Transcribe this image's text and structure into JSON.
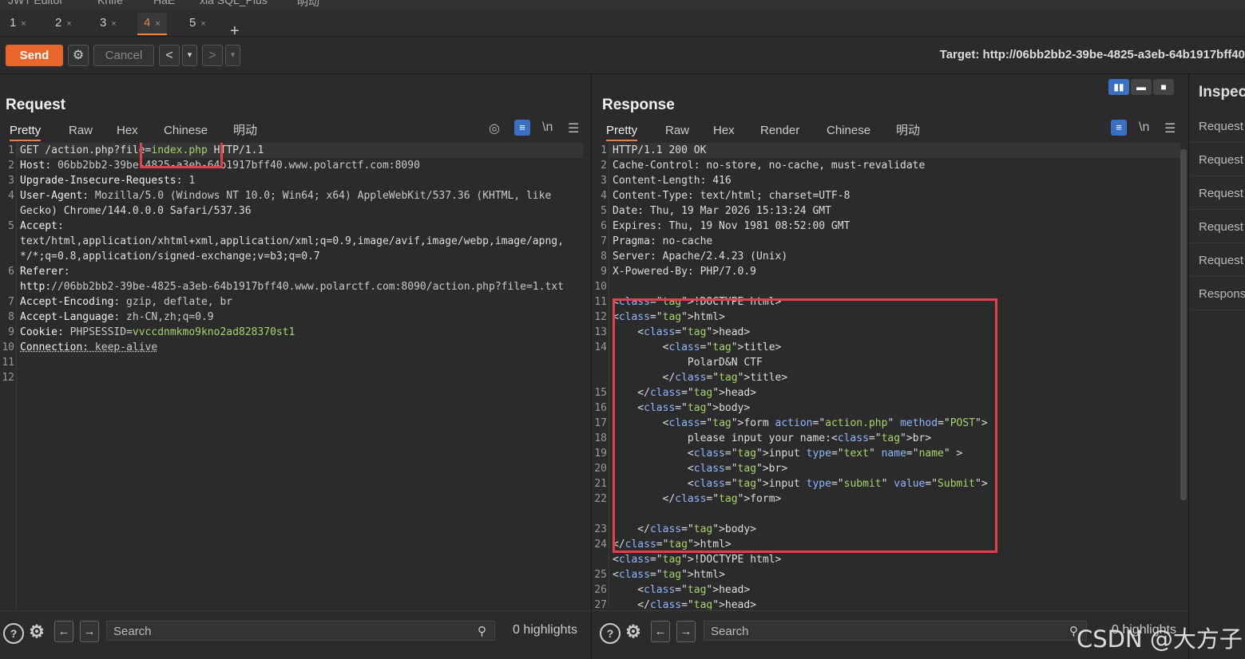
{
  "top_strip": [
    "JWT Editor",
    "Knife",
    "HaE",
    "xia SQL_Plus",
    "明动"
  ],
  "tabs": [
    {
      "label": "1",
      "active": false
    },
    {
      "label": "2",
      "active": false
    },
    {
      "label": "3",
      "active": false
    },
    {
      "label": "4",
      "active": true
    },
    {
      "label": "5",
      "active": false
    }
  ],
  "tab_close": "×",
  "toolbar": {
    "send_label": "Send",
    "cancel_label": "Cancel",
    "back_label": "<",
    "forward_label": ">",
    "dropdown": "▾",
    "target": "Target: http://06bb2bb2-39be-4825-a3eb-64b1917bff40"
  },
  "request": {
    "title": "Request",
    "tabs": [
      "Pretty",
      "Raw",
      "Hex",
      "Chinese",
      "明动"
    ],
    "active_tab": "Pretty",
    "newline_toggle": "\\n",
    "lines": [
      {
        "n": "1",
        "text": "GET /action.php?file=index.php HTTP/1.1"
      },
      {
        "n": "2",
        "text": "Host: 06bb2bb2-39be-4825-a3eb-64b1917bff40.www.polarctf.com:8090"
      },
      {
        "n": "3",
        "text": "Upgrade-Insecure-Requests: 1"
      },
      {
        "n": "4",
        "text": "User-Agent: Mozilla/5.0 (Windows NT 10.0; Win64; x64) AppleWebKit/537.36 (KHTML, like"
      },
      {
        "n": "",
        "text": "Gecko) Chrome/144.0.0.0 Safari/537.36"
      },
      {
        "n": "5",
        "text": "Accept:"
      },
      {
        "n": "",
        "text": "text/html,application/xhtml+xml,application/xml;q=0.9,image/avif,image/webp,image/apng,"
      },
      {
        "n": "",
        "text": "*/*;q=0.8,application/signed-exchange;v=b3;q=0.7"
      },
      {
        "n": "6",
        "text": "Referer:"
      },
      {
        "n": "",
        "text": "http://06bb2bb2-39be-4825-a3eb-64b1917bff40.www.polarctf.com:8090/action.php?file=1.txt"
      },
      {
        "n": "7",
        "text": "Accept-Encoding: gzip, deflate, br"
      },
      {
        "n": "8",
        "text": "Accept-Language: zh-CN,zh;q=0.9"
      },
      {
        "n": "9",
        "text": "Cookie: PHPSESSID=vvccdnmkmo9kno2ad828370st1"
      },
      {
        "n": "10",
        "text": "Connection: keep-alive"
      },
      {
        "n": "11",
        "text": ""
      },
      {
        "n": "12",
        "text": ""
      }
    ],
    "search_placeholder": "Search",
    "highlights": "0 highlights"
  },
  "response": {
    "title": "Response",
    "tabs": [
      "Pretty",
      "Raw",
      "Hex",
      "Render",
      "Chinese",
      "明动"
    ],
    "active_tab": "Pretty",
    "newline_toggle": "\\n",
    "lines": [
      {
        "n": "1",
        "text": "HTTP/1.1 200 OK"
      },
      {
        "n": "2",
        "text": "Cache-Control: no-store, no-cache, must-revalidate"
      },
      {
        "n": "3",
        "text": "Content-Length: 416"
      },
      {
        "n": "4",
        "text": "Content-Type: text/html; charset=UTF-8"
      },
      {
        "n": "5",
        "text": "Date: Thu, 19 Mar 2026 15:13:24 GMT"
      },
      {
        "n": "6",
        "text": "Expires: Thu, 19 Nov 1981 08:52:00 GMT"
      },
      {
        "n": "7",
        "text": "Pragma: no-cache"
      },
      {
        "n": "8",
        "text": "Server: Apache/2.4.23 (Unix)"
      },
      {
        "n": "9",
        "text": "X-Powered-By: PHP/7.0.9"
      },
      {
        "n": "10",
        "text": ""
      },
      {
        "n": "11",
        "text": "<!DOCTYPE html>"
      },
      {
        "n": "12",
        "text": "<html>"
      },
      {
        "n": "13",
        "text": "    <head>"
      },
      {
        "n": "14",
        "text": "        <title>"
      },
      {
        "n": "",
        "text": "            PolarD&N CTF"
      },
      {
        "n": "",
        "text": "        </title>"
      },
      {
        "n": "15",
        "text": "    </head>"
      },
      {
        "n": "16",
        "text": "    <body>"
      },
      {
        "n": "17",
        "text": "        <form action=\"action.php\" method=\"POST\">"
      },
      {
        "n": "18",
        "text": "            please input your name:<br>"
      },
      {
        "n": "19",
        "text": "            <input type=\"text\" name=\"name\" >"
      },
      {
        "n": "20",
        "text": "            <br>"
      },
      {
        "n": "21",
        "text": "            <input type=\"submit\" value=\"Submit\">"
      },
      {
        "n": "22",
        "text": "        </form>"
      },
      {
        "n": "",
        "text": ""
      },
      {
        "n": "23",
        "text": "    </body>"
      },
      {
        "n": "24",
        "text": "</html>"
      },
      {
        "n": "",
        "text": "<!DOCTYPE html>"
      },
      {
        "n": "25",
        "text": "<html>"
      },
      {
        "n": "26",
        "text": "    <head>"
      },
      {
        "n": "27",
        "text": "    </head>"
      }
    ],
    "search_placeholder": "Search",
    "highlights": "0 highlights"
  },
  "inspector": {
    "title": "Inspector",
    "items": [
      "Request attributes",
      "Request query parameters",
      "Request body parameters",
      "Request cookies",
      "Request headers",
      "Response headers"
    ]
  },
  "watermark": "CSDN @大方子",
  "colors": {
    "accent": "#e8652c",
    "highlight_box": "#e0424b",
    "selected_blue": "#3b6fc4"
  }
}
